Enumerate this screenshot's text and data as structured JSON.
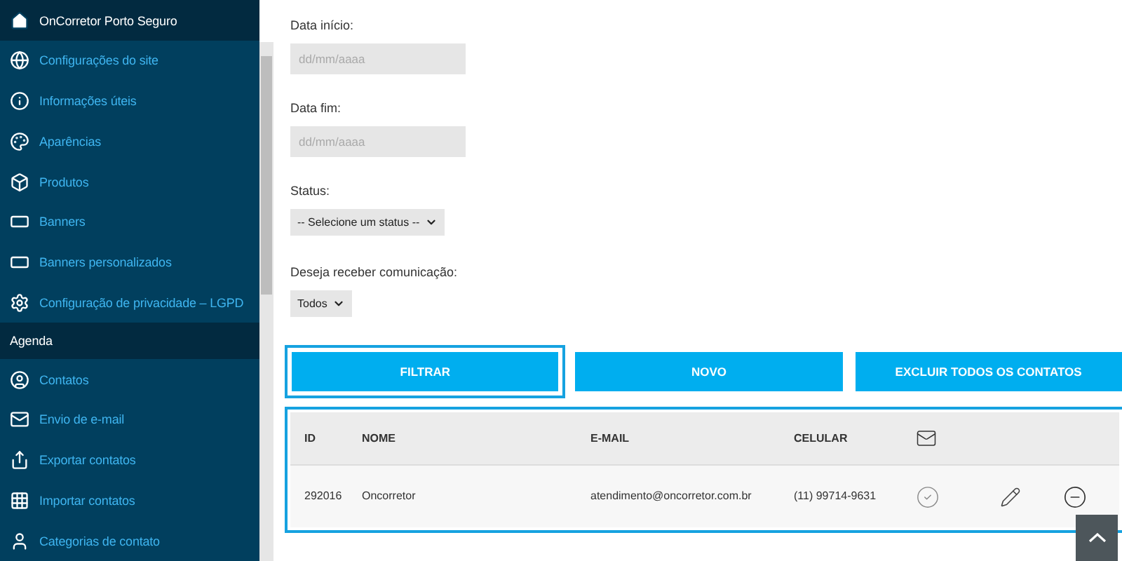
{
  "sidebar": {
    "items": [
      {
        "kind": "header",
        "label": "OnCorretor Porto Seguro"
      },
      {
        "kind": "item",
        "label": "Configurações do site"
      },
      {
        "kind": "item",
        "label": "Informações úteis"
      },
      {
        "kind": "item",
        "label": "Aparências"
      },
      {
        "kind": "item",
        "label": "Produtos"
      },
      {
        "kind": "item",
        "label": "Banners"
      },
      {
        "kind": "item",
        "label": "Banners personalizados"
      },
      {
        "kind": "item",
        "label": "Configuração de privacidade – LGPD"
      },
      {
        "kind": "section",
        "label": "Agenda"
      },
      {
        "kind": "item",
        "label": "Contatos"
      },
      {
        "kind": "item",
        "label": "Envio de e-mail"
      },
      {
        "kind": "item",
        "label": "Exportar contatos"
      },
      {
        "kind": "item",
        "label": "Importar contatos"
      },
      {
        "kind": "item",
        "label": "Categorias de contato"
      }
    ]
  },
  "filters": [
    {
      "kind": "date",
      "label": "Data início:",
      "placeholder": "dd/mm/aaaa"
    },
    {
      "kind": "date",
      "label": "Data fim:",
      "placeholder": "dd/mm/aaaa"
    },
    {
      "kind": "select",
      "label": "Status:",
      "value": "-- Selecione um status --"
    },
    {
      "kind": "select",
      "label": "Deseja receber comunicação:",
      "value": "Todos"
    }
  ],
  "buttons": [
    {
      "label": "FILTRAR",
      "highlighted": true
    },
    {
      "label": "NOVO",
      "highlighted": false
    },
    {
      "label": "EXCLUIR TODOS OS CONTATOS",
      "highlighted": false
    }
  ],
  "table": {
    "highlighted": true,
    "columns": [
      "ID",
      "NOME",
      "E-MAIL",
      "CELULAR"
    ],
    "rows": [
      {
        "id": "292016",
        "name": "Oncorretor",
        "email": "atendimento@oncorretor.com.br",
        "phone": "(11) 99714-9631"
      }
    ]
  }
}
